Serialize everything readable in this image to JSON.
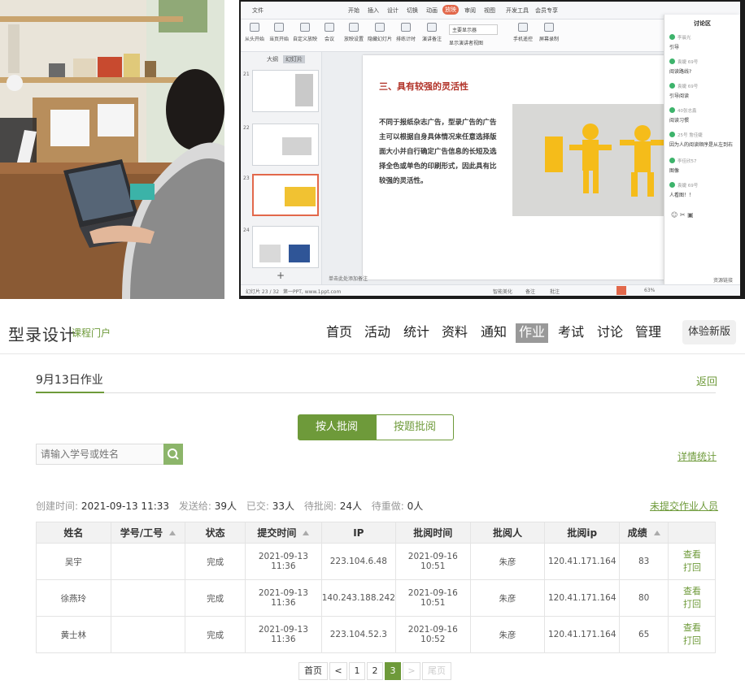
{
  "presentation": {
    "menu": [
      "文件",
      "开始",
      "插入",
      "设计",
      "切换",
      "动画",
      "放映",
      "审阅",
      "视图",
      "开发工具",
      "会员专享"
    ],
    "active_menu": "放映",
    "ribbon": [
      "从头开始",
      "当页开始",
      "自定义放映",
      "会议",
      "放映设置",
      "隐藏幻灯片",
      "排练计时",
      "演讲备注",
      "显示演讲者视图",
      "手机遥控",
      "屏幕录制"
    ],
    "ribbon_field": "主要显示器",
    "thumb_tabs": [
      "大纲",
      "幻灯片"
    ],
    "thumb_numbers": [
      "21",
      "22",
      "23",
      "24"
    ],
    "slide_title": "三、具有较强的灵活性",
    "slide_body": "不同于报纸杂志广告，型录广告的广告主可以根据自身具体情况来任意选择版面大小并自行确定广告信息的长短及选择全色或单色的印刷形式，因此具有比较强的灵活性。",
    "notes_hint": "单击此处添加备注",
    "status_left": "幻灯片 23 / 32",
    "status_theme": "第一PPT, www.1ppt.com",
    "status_right": [
      "智能美化",
      "备注",
      "批注"
    ],
    "zoom": "63%",
    "discussion_title": "讨论区",
    "messages": [
      {
        "who": "李晨光",
        "text": "引导"
      },
      {
        "who": "袁婕 69号",
        "text": "阅读路线?"
      },
      {
        "who": "袁婕 69号",
        "text": "引导阅读"
      },
      {
        "who": "40张志鑫",
        "text": "阅读习惯"
      },
      {
        "who": "25号 詹佳婕",
        "text": "因为人的阅读顺序是从左到右"
      },
      {
        "who": "李佳欣57",
        "text": "图像"
      },
      {
        "who": "袁婕 69号",
        "text": "人看图！！"
      }
    ],
    "discussion_footer": "资源链接"
  },
  "header": {
    "brand": "型录设计",
    "brand_sub": "课程门户",
    "nav": [
      "首页",
      "活动",
      "统计",
      "资料",
      "通知",
      "作业",
      "考试",
      "讨论",
      "管理"
    ],
    "active_nav": "作业",
    "try_new": "体验新版"
  },
  "page": {
    "title": "9月13日作业",
    "back": "返回",
    "seg_by_person": "按人批阅",
    "seg_by_question": "按题批阅",
    "search_placeholder": "请输入学号或姓名",
    "detail_stats": "详情统计",
    "info": {
      "created_label": "创建时间:",
      "created": "2021-09-13 11:33",
      "sent_label": "发送给:",
      "sent": "39人",
      "submitted_label": "已交:",
      "submitted": "33人",
      "pending_label": "待批阅:",
      "pending": "24人",
      "redo_label": "待重做:",
      "redo": "0人"
    },
    "unsubmitted": "未提交作业人员"
  },
  "table": {
    "columns": [
      "姓名",
      "学号/工号",
      "状态",
      "提交时间",
      "IP",
      "批阅时间",
      "批阅人",
      "批阅ip",
      "成绩"
    ],
    "rows": [
      {
        "name": "吴宇",
        "sid": "",
        "status": "完成",
        "submit": "2021-09-13 11:36",
        "ip": "223.104.6.48",
        "review_time": "2021-09-16 10:51",
        "reviewer": "朱彦",
        "review_ip": "120.41.171.164",
        "score": "83",
        "op1": "查看",
        "op2": "打回"
      },
      {
        "name": "徐燕玲",
        "sid": "",
        "status": "完成",
        "submit": "2021-09-13 11:36",
        "ip": "140.243.188.242",
        "review_time": "2021-09-16 10:51",
        "reviewer": "朱彦",
        "review_ip": "120.41.171.164",
        "score": "80",
        "op1": "查看",
        "op2": "打回"
      },
      {
        "name": "黄士林",
        "sid": "",
        "status": "完成",
        "submit": "2021-09-13 11:36",
        "ip": "223.104.52.3",
        "review_time": "2021-09-16 10:52",
        "reviewer": "朱彦",
        "review_ip": "120.41.171.164",
        "score": "65",
        "op1": "查看",
        "op2": "打回"
      }
    ]
  },
  "pagination": {
    "first": "首页",
    "prev": "<",
    "pages": [
      "1",
      "2",
      "3"
    ],
    "current": "3",
    "next": ">",
    "last": "尾页"
  },
  "colors": {
    "accent": "#6e9a3a",
    "slide_title": "#b2342a",
    "active_nav": "#999999"
  }
}
